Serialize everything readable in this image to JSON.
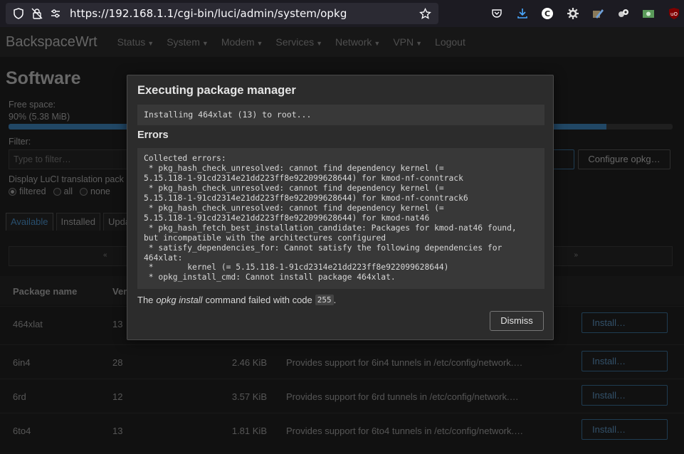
{
  "browser": {
    "url_host": "https://192.168.1.1",
    "url_path": "/cgi-bin/luci/admin/system/opkg"
  },
  "luci": {
    "brand": "BackspaceWrt",
    "nav": [
      "Status",
      "System",
      "Modem",
      "Services",
      "Network",
      "VPN",
      "Logout"
    ],
    "page_title": "Software",
    "free_space_label": "Free space:",
    "free_space_value": "90% (5.38 MiB)",
    "free_space_fraction": 0.9,
    "filter_label": "Filter:",
    "filter_placeholder": "Type to filter…",
    "configure_label": "Configure opkg…",
    "display_translation_label": "Display LuCI translation pack",
    "radio_filtered": "filtered",
    "radio_all": "all",
    "radio_none": "none",
    "tabs": [
      "Available",
      "Installed",
      "Upda"
    ],
    "pager_prev": "«",
    "pager_next": "»",
    "col_package": "Package name",
    "col_version": "Ver",
    "install_label": "Install…",
    "rows": [
      {
        "name": "464xlat",
        "version": "13",
        "size": "",
        "desc": ""
      },
      {
        "name": "6in4",
        "version": "28",
        "size": "2.46 KiB",
        "desc": "Provides support for 6in4 tunnels in /etc/config/network.…"
      },
      {
        "name": "6rd",
        "version": "12",
        "size": "3.57 KiB",
        "desc": "Provides support for 6rd tunnels in /etc/config/network.…"
      },
      {
        "name": "6to4",
        "version": "13",
        "size": "1.81 KiB",
        "desc": "Provides support for 6to4 tunnels in /etc/config/network.…"
      }
    ]
  },
  "modal": {
    "title": "Executing package manager",
    "status": "Installing 464xlat (13) to root...",
    "errors_heading": "Errors",
    "errors_text": "Collected errors:\n * pkg_hash_check_unresolved: cannot find dependency kernel (=\n5.15.118-1-91cd2314e21dd223ff8e922099628644) for kmod-nf-conntrack\n * pkg_hash_check_unresolved: cannot find dependency kernel (=\n5.15.118-1-91cd2314e21dd223ff8e922099628644) for kmod-nf-conntrack6\n * pkg_hash_check_unresolved: cannot find dependency kernel (=\n5.15.118-1-91cd2314e21dd223ff8e922099628644) for kmod-nat46\n * pkg_hash_fetch_best_installation_candidate: Packages for kmod-nat46 found,\nbut incompatible with the architectures configured\n * satisfy_dependencies_for: Cannot satisfy the following dependencies for\n464xlat:\n *       kernel (= 5.15.118-1-91cd2314e21dd223ff8e922099628644)\n * opkg_install_cmd: Cannot install package 464xlat.",
    "failed_prefix": "The",
    "failed_cmd": "opkg install",
    "failed_suffix": "command failed with code",
    "failed_code": "255",
    "failed_end": ".",
    "dismiss": "Dismiss"
  }
}
